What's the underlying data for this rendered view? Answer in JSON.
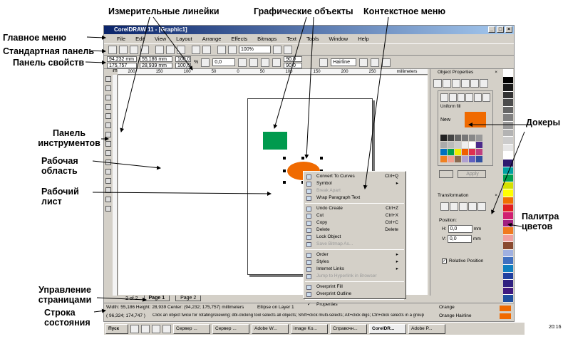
{
  "annotations": {
    "rulers": "Измерительные линейки",
    "objects": "Графические объекты",
    "context_menu": "Контекстное меню",
    "main_menu": "Главное меню",
    "standard_bar": "Стандартная панель",
    "property_bar": "Панель свойств",
    "toolbox": "Панель инструментов",
    "work_area": "Рабочая область",
    "work_sheet": "Рабочий лист",
    "dockers": "Докеры",
    "palette": "Палитра цветов",
    "page_control": "Управление страницами",
    "status_line": "Строка состояния"
  },
  "window": {
    "title": "CorelDRAW 11 - [Graphic1]"
  },
  "menu": [
    "File",
    "Edit",
    "View",
    "Layout",
    "Arrange",
    "Effects",
    "Bitmaps",
    "Text",
    "Tools",
    "Window",
    "Help"
  ],
  "toolbar": {
    "zoom": "100%"
  },
  "property_bar": {
    "x": "94,232 mm",
    "y": "175,757 mm",
    "width": "55,186 mm",
    "height": "28,939 mm",
    "scale_x": "100,0",
    "scale_y": "100,0",
    "pct": "%",
    "angle": "0,0",
    "deg1": "90,0",
    "deg2": "90,0",
    "outline": "Hairline"
  },
  "ruler": {
    "ticks": [
      "200",
      "150",
      "100",
      "50",
      "0",
      "50",
      "100",
      "150",
      "200",
      "250"
    ],
    "unit": "millimeters"
  },
  "context_menu": {
    "items": [
      {
        "label": "Convert To Curves",
        "shortcut": "Ctrl+Q"
      },
      {
        "label": "Symbol",
        "sub": true
      },
      {
        "label": "Break Apart",
        "disabled": true
      },
      {
        "label": "Wrap Paragraph Text"
      },
      {
        "sep": true
      },
      {
        "label": "Undo Create",
        "shortcut": "Ctrl+Z"
      },
      {
        "label": "Cut",
        "shortcut": "Ctrl+X"
      },
      {
        "label": "Copy",
        "shortcut": "Ctrl+C"
      },
      {
        "label": "Delete",
        "shortcut": "Delete"
      },
      {
        "label": "Lock Object"
      },
      {
        "label": "Save Bitmap As...",
        "disabled": true
      },
      {
        "sep": true
      },
      {
        "label": "Order",
        "sub": true
      },
      {
        "label": "Styles",
        "sub": true
      },
      {
        "label": "Internet Links",
        "sub": true
      },
      {
        "label": "Jump to Hyperlink in Browser",
        "disabled": true
      },
      {
        "sep": true
      },
      {
        "label": "Overprint Fill"
      },
      {
        "label": "Overprint Outline"
      },
      {
        "sep": true
      },
      {
        "label": "Properties",
        "checked": true
      }
    ]
  },
  "object_properties": {
    "title": "Object Properties",
    "group": "Uniform fill",
    "color_name": "New",
    "apply": "Apply"
  },
  "transformation": {
    "title": "Transformation",
    "position": "Position:",
    "h_label": "H:",
    "h": "0,0",
    "v_label": "V:",
    "v": "0,0",
    "unit": "mm",
    "relative": "Relative Position"
  },
  "page_tabs": {
    "counter": "2 of 2",
    "tabs": [
      "Page 1",
      "Page 2"
    ]
  },
  "status": {
    "line1": "Width: 55,186  Height: 28,939  Center: (94,232; 175,757)  millimeters",
    "layer": "Ellipse on Layer 1",
    "coords": "( 96,324; 174,747 )",
    "hint": "Click an object twice for rotating/skewing; dbl-clicking tool selects all objects; Shift+click multi-selects; Alt+click digs; Ctrl+click selects in a group",
    "fill": "Orange",
    "outline": "Orange  Hairline"
  },
  "taskbar": {
    "start": "Пуск",
    "tasks": [
      "Сервер ...",
      "Сервер ...",
      "Adobe W...",
      "image Ko...",
      "Справочн...",
      "CorelDR...",
      "Adobe P..."
    ],
    "clock": "20:16"
  },
  "colors": {
    "orange": "#f06a00",
    "green": "#009a4e",
    "title": "#0a246a"
  },
  "palette": [
    "#ffffff",
    "#000000",
    "#1a1a1a",
    "#333333",
    "#4d4d4d",
    "#666666",
    "#808080",
    "#999999",
    "#b3b3b3",
    "#cccccc",
    "#e6e6e6",
    "#ffffff",
    "#2e1a6e",
    "#00a0a0",
    "#00a050",
    "#d4e000",
    "#ffff00",
    "#f07000",
    "#e02020",
    "#d02070",
    "#a02080",
    "#f07a20",
    "#f0a0a0",
    "#8a4a30",
    "#a0b0e0",
    "#4070c0",
    "#1080c0",
    "#2040a0",
    "#302080",
    "#401a80",
    "#2050a0"
  ],
  "fill_swatches": [
    "#222222",
    "#444444",
    "#666666",
    "#777777",
    "#888888",
    "#999999",
    "#aaaaaa",
    "#bbbbbb",
    "#cccccc",
    "#eeeeee",
    "#ffffff",
    "#4b2a8a",
    "#0070c0",
    "#00a050",
    "#f0f000",
    "#f06000",
    "#e03050",
    "#c04080",
    "#f08020",
    "#f0a090",
    "#8a6a50",
    "#b0a0d0",
    "#6060c0",
    "#3050a0"
  ]
}
